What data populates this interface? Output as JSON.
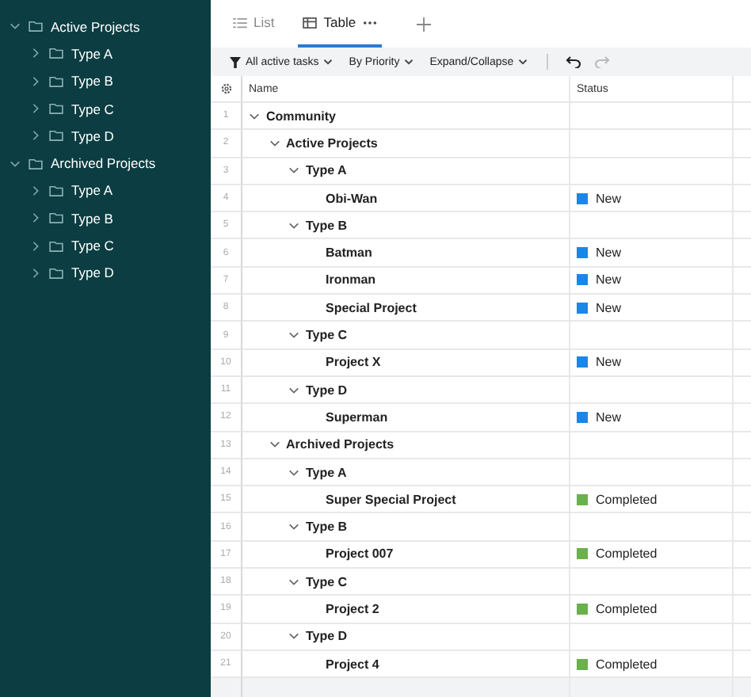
{
  "sidebar": {
    "items": [
      {
        "label": "Active Projects",
        "expanded": true,
        "children": [
          {
            "label": "Type A",
            "expanded": false
          },
          {
            "label": "Type B",
            "expanded": false
          },
          {
            "label": "Type C",
            "expanded": false
          },
          {
            "label": "Type D",
            "expanded": false
          }
        ]
      },
      {
        "label": "Archived Projects",
        "expanded": true,
        "children": [
          {
            "label": "Type A",
            "expanded": false
          },
          {
            "label": "Type B",
            "expanded": false
          },
          {
            "label": "Type C",
            "expanded": false
          },
          {
            "label": "Type D",
            "expanded": false
          }
        ]
      }
    ]
  },
  "tabs": [
    {
      "label": "List",
      "selected": false
    },
    {
      "label": "Table",
      "selected": true
    }
  ],
  "toolbar": {
    "filters": [
      {
        "label": "All active tasks",
        "kind": "filter"
      },
      {
        "label": "By Priority",
        "kind": "sort"
      },
      {
        "label": "Expand/Collapse",
        "kind": "plain"
      }
    ],
    "undo": {
      "disabled": false
    },
    "redo": {
      "disabled": true
    }
  },
  "table": {
    "columns": [
      "Name",
      "Status"
    ],
    "rows": [
      {
        "num": "1",
        "name": "Community",
        "expanded": true,
        "children": [
          {
            "num": "2",
            "name": "Active Projects",
            "expanded": true,
            "children": [
              {
                "num": "3",
                "name": "Type A",
                "expanded": true,
                "children": [
                  {
                    "num": "4",
                    "name": "Obi-Wan",
                    "status": {
                      "label": "New",
                      "color": "#1a86e8"
                    }
                  }
                ]
              },
              {
                "num": "5",
                "name": "Type B",
                "expanded": true,
                "children": [
                  {
                    "num": "6",
                    "name": "Batman",
                    "status": {
                      "label": "New",
                      "color": "#1a86e8"
                    }
                  },
                  {
                    "num": "7",
                    "name": "Ironman",
                    "status": {
                      "label": "New",
                      "color": "#1a86e8"
                    }
                  },
                  {
                    "num": "8",
                    "name": "Special Project",
                    "status": {
                      "label": "New",
                      "color": "#1a86e8"
                    }
                  }
                ]
              },
              {
                "num": "9",
                "name": "Type C",
                "expanded": true,
                "children": [
                  {
                    "num": "10",
                    "name": "Project X",
                    "status": {
                      "label": "New",
                      "color": "#1a86e8"
                    }
                  }
                ]
              },
              {
                "num": "11",
                "name": "Type D",
                "expanded": true,
                "children": [
                  {
                    "num": "12",
                    "name": "Superman",
                    "status": {
                      "label": "New",
                      "color": "#1a86e8"
                    }
                  }
                ]
              }
            ]
          },
          {
            "num": "13",
            "name": "Archived Projects",
            "expanded": true,
            "children": [
              {
                "num": "14",
                "name": "Type A",
                "expanded": true,
                "children": [
                  {
                    "num": "15",
                    "name": "Super Special Project",
                    "status": {
                      "label": "Completed",
                      "color": "#6ab04c"
                    }
                  }
                ]
              },
              {
                "num": "16",
                "name": "Type B",
                "expanded": true,
                "children": [
                  {
                    "num": "17",
                    "name": "Project 007",
                    "status": {
                      "label": "Completed",
                      "color": "#6ab04c"
                    }
                  }
                ]
              },
              {
                "num": "18",
                "name": "Type C",
                "expanded": true,
                "children": [
                  {
                    "num": "19",
                    "name": "Project 2",
                    "status": {
                      "label": "Completed",
                      "color": "#6ab04c"
                    }
                  }
                ]
              },
              {
                "num": "20",
                "name": "Type D",
                "expanded": true,
                "children": [
                  {
                    "num": "21",
                    "name": "Project 4",
                    "status": {
                      "label": "Completed",
                      "color": "#6ab04c"
                    }
                  }
                ]
              }
            ]
          }
        ]
      }
    ]
  }
}
